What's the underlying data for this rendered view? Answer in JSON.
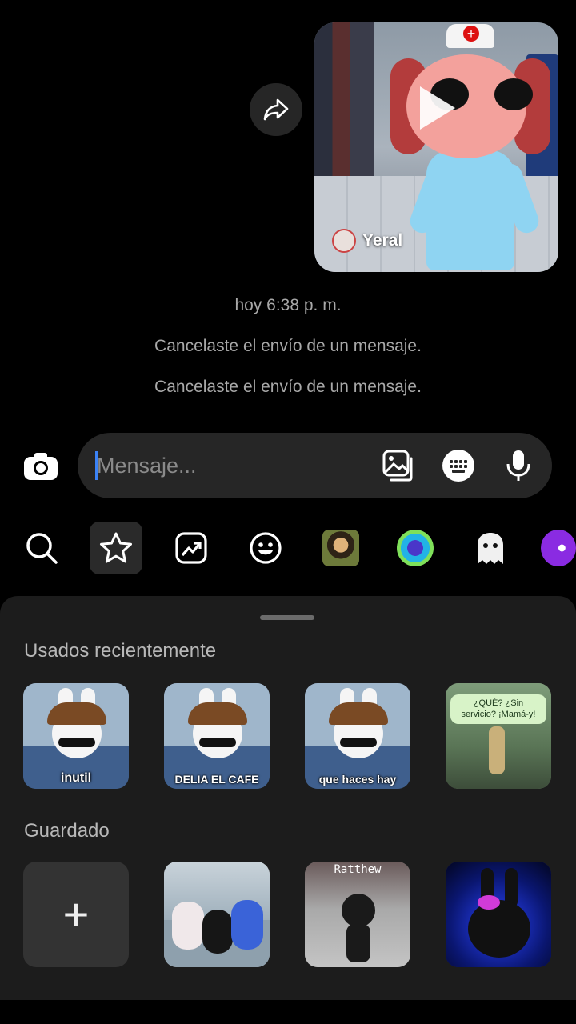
{
  "reel": {
    "author": "Yeral"
  },
  "chat": {
    "timestamp": "hoy 6:38 p. m.",
    "system_messages": [
      "Cancelaste el envío de un mensaje.",
      "Cancelaste el envío de un mensaje."
    ]
  },
  "composer": {
    "placeholder": "Mensaje..."
  },
  "tray": {
    "items": [
      "search-icon",
      "star-icon",
      "trending-icon",
      "emoji-icon",
      "mona-lisa-sticker",
      "blob-sticker",
      "ghost-sticker",
      "purple-sticker"
    ],
    "active": "star-icon"
  },
  "sheet": {
    "recent_title": "Usados recientemente",
    "saved_title": "Guardado",
    "recent_stickers": [
      {
        "caption": "inutil"
      },
      {
        "caption": "DELIA EL CAFE"
      },
      {
        "caption": "que haces hay"
      },
      {
        "caption": "¿QUÉ? ¿Sin servicio? ¡Mamá-y!"
      }
    ],
    "saved_stickers": [
      {
        "caption": "+"
      },
      {
        "caption": ""
      },
      {
        "caption": "Ratthew"
      },
      {
        "caption": ""
      }
    ]
  },
  "colors": {
    "background": "#000000",
    "composer_bg": "#262626",
    "sheet_bg": "#1c1c1c",
    "caret": "#3b82f6",
    "secondary_text": "#a8a8a8"
  }
}
